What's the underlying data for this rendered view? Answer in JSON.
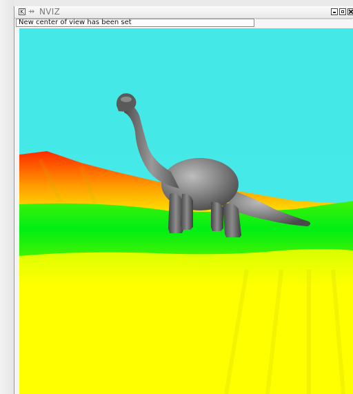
{
  "window": {
    "title": "NVIZ",
    "controls": [
      "minimize",
      "maximize",
      "close"
    ]
  },
  "status": {
    "message": "New center of view has been set"
  },
  "scene": {
    "sky_color": "#44e8e6",
    "terrain_colors": [
      "#ff2200",
      "#ffd400",
      "#00ee10",
      "#ffff00"
    ],
    "model_color": "#7e7e7e"
  },
  "icons": {
    "app": "kde-app-icon",
    "pin": "pin-icon",
    "minimize": "minimize-icon",
    "maximize": "maximize-icon",
    "close": "close-icon"
  }
}
